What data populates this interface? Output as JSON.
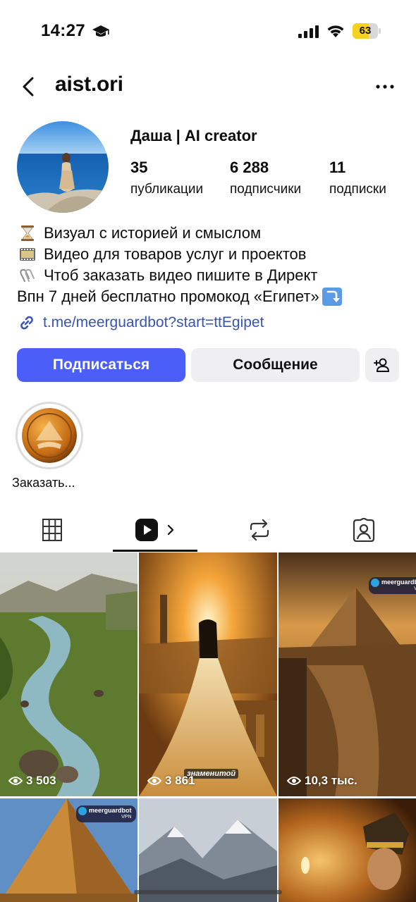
{
  "status_bar": {
    "time": "14:27",
    "battery_level": "63",
    "battery_fraction": 0.63,
    "icons": [
      "graduation-cap-icon",
      "cellular-signal-icon",
      "wifi-icon",
      "battery-icon"
    ]
  },
  "header": {
    "username": "aist.ori",
    "icons": [
      "chevron-left-icon",
      "more-dots-icon"
    ]
  },
  "profile": {
    "display_name": "Даша | AI creator",
    "stats": [
      {
        "value": "35",
        "label": "публикации"
      },
      {
        "value": "6 288",
        "label": "подписчики"
      },
      {
        "value": "11",
        "label": "подписки"
      }
    ]
  },
  "bio": {
    "lines": [
      {
        "emoji": "hourglass-icon",
        "text": "Визуал с историей и смыслом"
      },
      {
        "emoji": "film-frames-icon",
        "text": "Видео для товаров услуг и проектов"
      },
      {
        "emoji": "paperclips-icon",
        "text": "Чтоб заказать видео пишите в Директ"
      },
      {
        "emoji": "",
        "text": "Впн 7 дней бесплатно промокод «Египет»",
        "end_emoji": "arrow-down-box-icon"
      }
    ],
    "link": "t.me/meerguardbot?start=ttEgipet"
  },
  "actions": {
    "follow": "Подписаться",
    "message": "Сообщение",
    "add_friend_icon": "add-person-icon"
  },
  "highlights": [
    {
      "label": "Заказать..."
    }
  ],
  "tabs": [
    {
      "icon": "grid-icon"
    },
    {
      "icon": "reels-icon",
      "active": true
    },
    {
      "icon": "repost-icon"
    },
    {
      "icon": "tagged-icon"
    }
  ],
  "posts": [
    {
      "views": "3 503"
    },
    {
      "views": "3 861",
      "caption": "знаменитой"
    },
    {
      "views": "10,3 тыс.",
      "badge": "meerguardbot",
      "badge_sub": "VPN"
    },
    {
      "views": "",
      "badge": "meerguardbot",
      "badge_sub": "VPN"
    },
    {
      "views": ""
    },
    {
      "views": ""
    }
  ],
  "colors": {
    "accent": "#4c5ef8",
    "link": "#3855b3",
    "battery": "#f4d21f",
    "secondary_button": "#efeff1"
  }
}
